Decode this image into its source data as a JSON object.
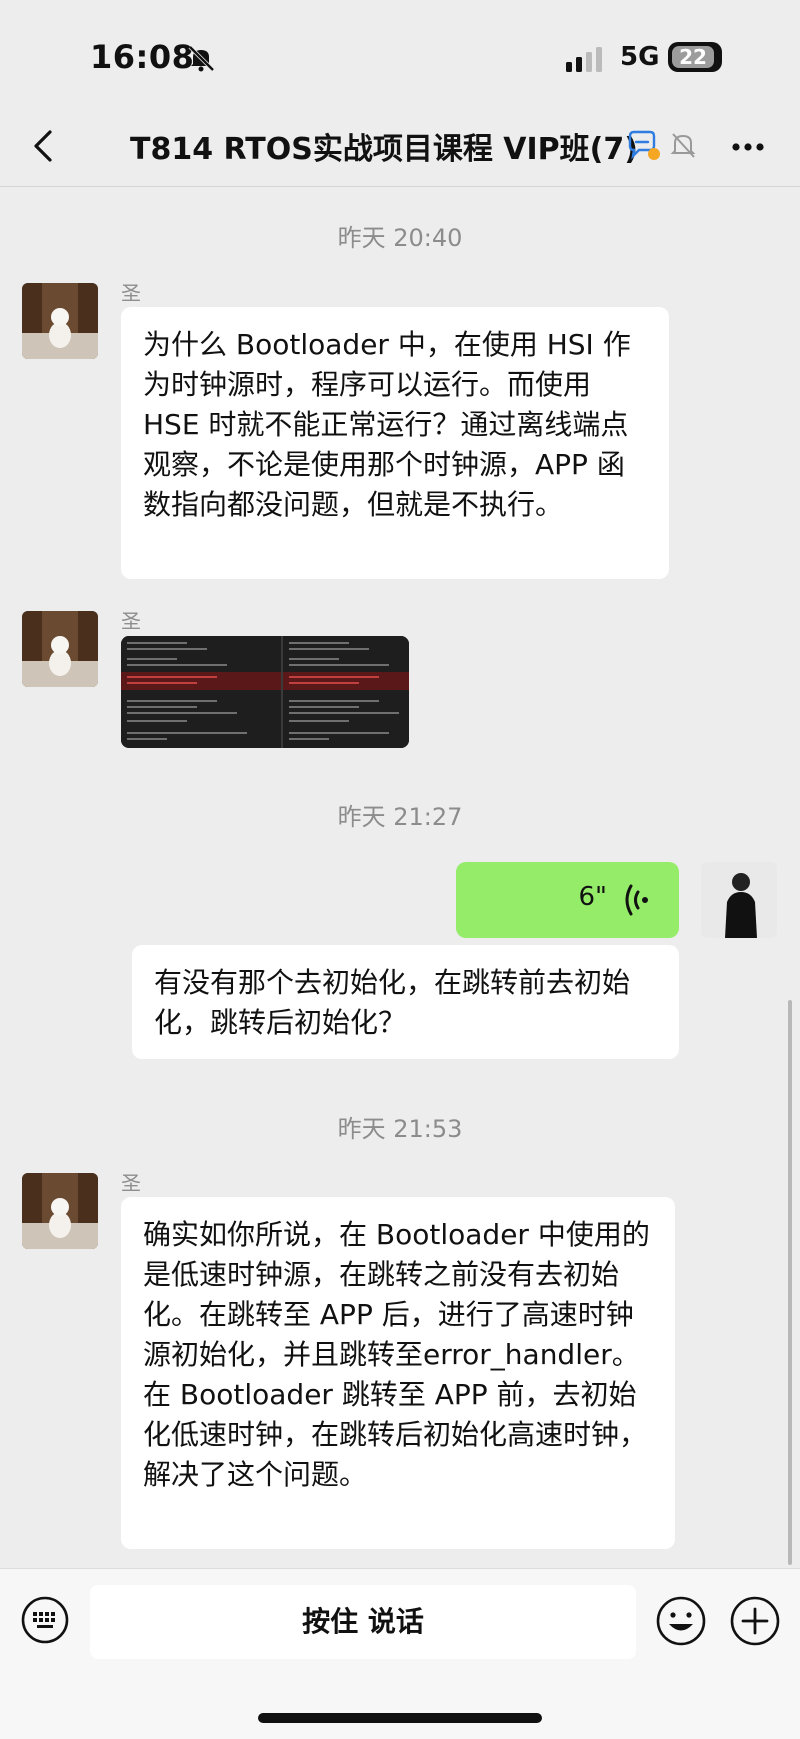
{
  "status_bar": {
    "time": "16:08",
    "network": "5G",
    "battery": "22"
  },
  "header": {
    "title": "T814 RTOS实战项目课程 VIP班(7)"
  },
  "messages": {
    "ts1": "昨天 20:40",
    "sender1": "圣",
    "msg1": "为什么 Bootloader 中，在使用 HSI 作为时钟源时，程序可以运行。而使用 HSE 时就不能正常运行？通过离线端点观察，不论是使用那个时钟源，APP 函数指向都没问题，但就是不执行。",
    "sender2": "圣",
    "ts2": "昨天 21:27",
    "voice_duration": "6\"",
    "msg3": "有没有那个去初始化，在跳转前去初始化，跳转后初始化？",
    "ts3": "昨天 21:53",
    "sender4": "圣",
    "msg4": "确实如你所说，在 Bootloader 中使用的是低速时钟源，在跳转之前没有去初始化。在跳转至 APP 后，进行了高速时钟源初始化，并且跳转至error_handler。在 Bootloader 跳转至 APP 前，去初始化低速时钟，在跳转后初始化高速时钟，解决了这个问题。"
  },
  "input_bar": {
    "hold_to_talk": "按住 说话"
  },
  "colors": {
    "background": "#ededed",
    "my_bubble": "#95ec69",
    "other_bubble": "#ffffff",
    "accent_blue": "#2f7de1"
  }
}
